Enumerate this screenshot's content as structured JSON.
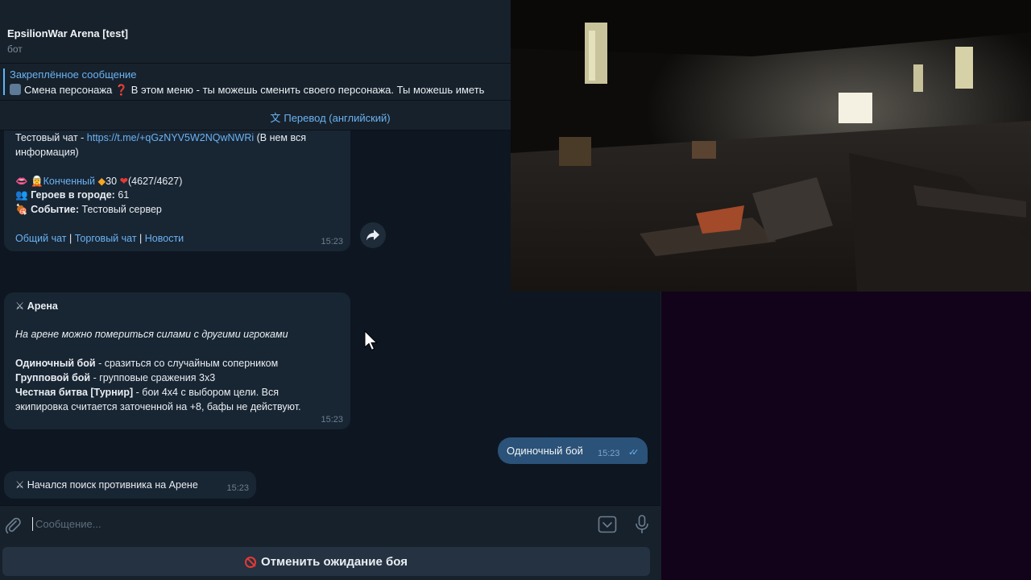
{
  "header": {
    "title": "EpsilionWar Arena [test]",
    "subtitle": "бот"
  },
  "pinned": {
    "title": "Закреплённое сообщение",
    "text": "Смена персонажа ❓ В этом меню - ты можешь сменить своего персонажа. Ты можешь иметь"
  },
  "translate_bar": {
    "label": "Перевод (английский)"
  },
  "messages": {
    "info": {
      "test_chat_prefix": "Тестовый чат - ",
      "test_chat_link": "https://t.me/+qGzNYV5W2NQwNWRi",
      "test_chat_suffix": " (В нем вся",
      "test_chat_suffix2": "информация)",
      "char_name": "Конченный",
      "char_level": "30",
      "char_hp": "(4627/4627)",
      "heroes_label": "Героев в городе:",
      "heroes_value": "61",
      "event_label": "Событие:",
      "event_value": "Тестовый сервер",
      "link_general": "Общий чат",
      "link_trade": "Торговый чат",
      "link_news": "Новости",
      "separator": "|",
      "time": "15:23"
    },
    "arena": {
      "title": "Арена",
      "intro": "На арене можно помериться силами с другими игроками",
      "single_bold": "Одиночный бой",
      "single_text": " - сразиться со случайным соперником",
      "group_bold": "Групповой бой",
      "group_text": " - групповые сражения 3x3",
      "fair_bold": "Честная битва [Турнир]",
      "fair_text": " - бои 4x4 с выбором цели. Вся",
      "fair_text2": "экипировка считается заточенной на +8, бафы не действуют.",
      "time": "15:23"
    },
    "own": {
      "text": "Одиночный бой",
      "time": "15:23"
    },
    "search": {
      "text": "Начался поиск противника на Арене",
      "time": "15:23"
    }
  },
  "input": {
    "placeholder": "Сообщение..."
  },
  "keyboard": {
    "cancel_label": "Отменить ожидание боя"
  },
  "colors": {
    "link": "#6ab3f3",
    "bubble": "#182533",
    "own_bubble": "#2b5278",
    "cancel_icon": "#e53935"
  }
}
